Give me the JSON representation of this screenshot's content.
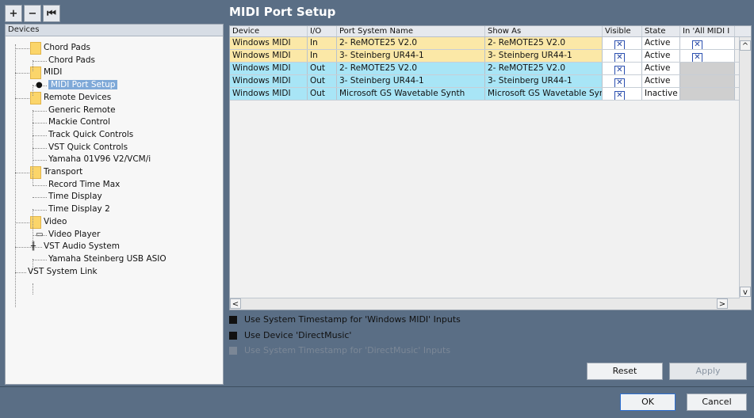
{
  "toolbar": {
    "add_label": "+",
    "remove_label": "−",
    "collapse_label": "⏮"
  },
  "left_panel": {
    "header": "Devices",
    "tree": [
      {
        "label": "Chord Pads",
        "folder": true
      },
      {
        "label": "Chord Pads"
      },
      {
        "label": "MIDI",
        "folder": true
      },
      {
        "label": "MIDI Port Setup",
        "selected": true
      },
      {
        "label": "Remote Devices",
        "folder": true
      },
      {
        "label": "Generic Remote"
      },
      {
        "label": "Mackie Control"
      },
      {
        "label": "Track Quick Controls"
      },
      {
        "label": "VST Quick Controls"
      },
      {
        "label": "Yamaha 01V96 V2/VCM/i"
      },
      {
        "label": "Transport",
        "folder": true
      },
      {
        "label": "Record Time Max"
      },
      {
        "label": "Time Display"
      },
      {
        "label": "Time Display 2"
      },
      {
        "label": "Video",
        "folder": true
      },
      {
        "label": "Video Player"
      },
      {
        "label": "VST Audio System"
      },
      {
        "label": "Yamaha Steinberg USB ASIO"
      },
      {
        "label": "VST System Link"
      }
    ]
  },
  "main": {
    "title": "MIDI Port Setup",
    "columns": [
      "Device",
      "I/O",
      "Port System Name",
      "Show As",
      "Visible",
      "State",
      "In 'All MIDI I"
    ],
    "rows": [
      {
        "device": "Windows MIDI",
        "io": "In",
        "port": "2- ReMOTE25 V2.0",
        "show_as": "2- ReMOTE25 V2.0",
        "visible": "✕",
        "state": "Active",
        "all_midi": "✕"
      },
      {
        "device": "Windows MIDI",
        "io": "In",
        "port": "3- Steinberg UR44-1",
        "show_as": "3- Steinberg UR44-1",
        "visible": "✕",
        "state": "Active",
        "all_midi": "✕"
      },
      {
        "device": "Windows MIDI",
        "io": "Out",
        "port": "2- ReMOTE25 V2.0",
        "show_as": "2- ReMOTE25 V2.0",
        "visible": "✕",
        "state": "Active",
        "all_midi": ""
      },
      {
        "device": "Windows MIDI",
        "io": "Out",
        "port": "3- Steinberg UR44-1",
        "show_as": "3- Steinberg UR44-1",
        "visible": "✕",
        "state": "Active",
        "all_midi": ""
      },
      {
        "device": "Windows MIDI",
        "io": "Out",
        "port": "Microsoft GS Wavetable Synth",
        "show_as": "Microsoft GS Wavetable Synth",
        "visible": "✕",
        "state": "Inactive",
        "all_midi": ""
      }
    ],
    "options": [
      {
        "label": "Use System Timestamp for 'Windows MIDI' Inputs",
        "enabled": true
      },
      {
        "label": "Use Device 'DirectMusic'",
        "enabled": true
      },
      {
        "label": "Use System Timestamp for 'DirectMusic' Inputs",
        "enabled": false
      }
    ],
    "buttons": {
      "reset": "Reset",
      "apply": "Apply"
    }
  },
  "footer": {
    "ok": "OK",
    "cancel": "Cancel"
  },
  "scroll": {
    "up": "^",
    "down": "v",
    "left": "<",
    "right": ">"
  }
}
